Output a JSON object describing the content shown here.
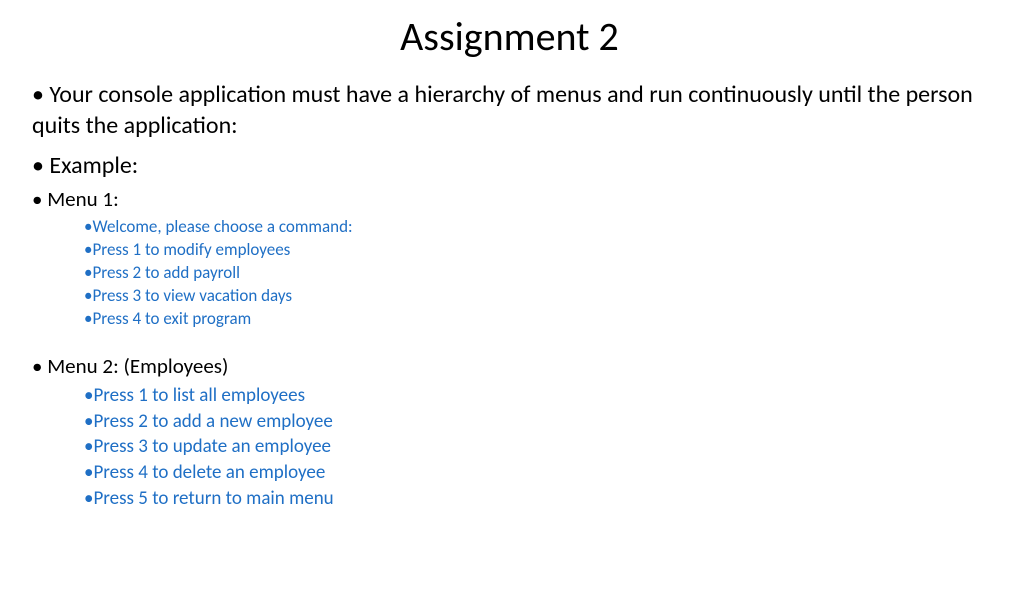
{
  "title": "Assignment 2",
  "intro": "Your console application must have a hierarchy of menus and run continuously until the person quits the application:",
  "example_label": "Example:",
  "menu1": {
    "label": "Menu 1:",
    "items": [
      "Welcome, please choose a command:",
      "Press 1 to modify employees",
      "Press 2 to add payroll",
      "Press 3 to view vacation days",
      "Press 4 to exit program"
    ]
  },
  "menu2": {
    "label": "Menu 2: (Employees)",
    "items": [
      "Press 1 to list all employees",
      "Press 2 to add a new employee",
      "Press 3 to update an employee",
      "Press 4 to delete an employee",
      "Press 5 to return to main menu"
    ]
  }
}
